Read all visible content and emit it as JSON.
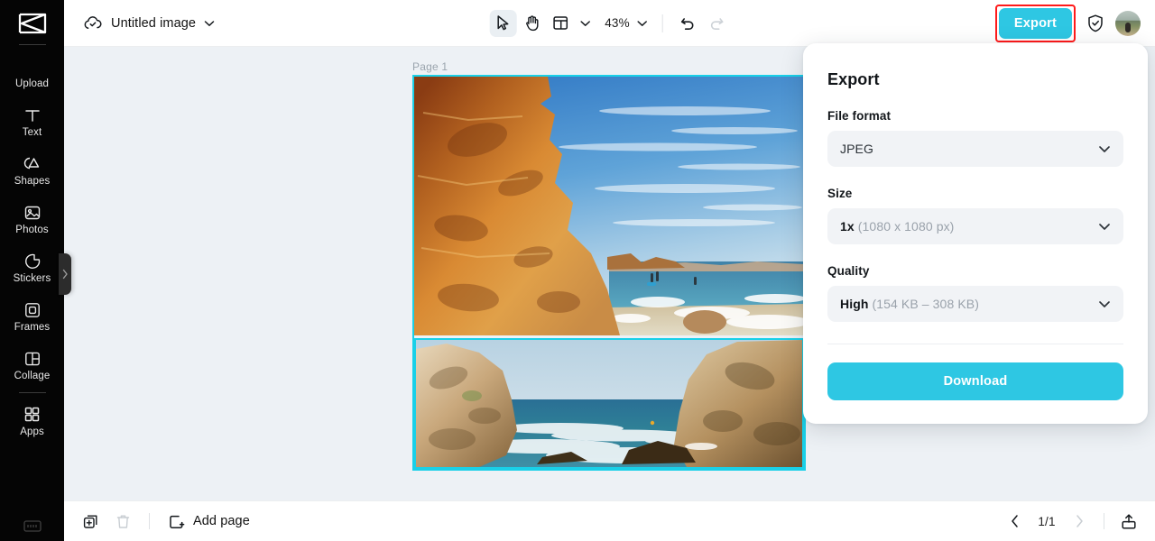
{
  "sidebar": {
    "logo_icon": "app-logo-icon",
    "items": [
      {
        "label": "Upload",
        "icon": "upload-icon"
      },
      {
        "label": "Text",
        "icon": "text-icon"
      },
      {
        "label": "Shapes",
        "icon": "shapes-icon"
      },
      {
        "label": "Photos",
        "icon": "photos-icon"
      },
      {
        "label": "Stickers",
        "icon": "stickers-icon"
      },
      {
        "label": "Frames",
        "icon": "frames-icon"
      },
      {
        "label": "Collage",
        "icon": "collage-icon"
      },
      {
        "label": "Apps",
        "icon": "apps-icon"
      }
    ],
    "bottom_icon": "keyboard-shortcuts-icon",
    "collapse_icon": "chevron-right-icon"
  },
  "topbar": {
    "cloud_icon": "cloud-saved-icon",
    "document_title": "Untitled image",
    "title_chevron_icon": "chevron-down-icon",
    "tools": [
      {
        "name": "select-tool",
        "icon": "cursor-arrow-icon",
        "active": true
      },
      {
        "name": "pan-tool",
        "icon": "hand-icon",
        "active": false
      },
      {
        "name": "resize-tool",
        "icon": "layout-resize-icon",
        "active": false
      }
    ],
    "resize_chevron_icon": "chevron-down-icon",
    "zoom_level": "43%",
    "zoom_chevron_icon": "chevron-down-icon",
    "undo_icon": "undo-icon",
    "redo_icon": "redo-icon",
    "export_label": "Export",
    "export_highlight_color": "#ff1a1a",
    "shield_icon": "shield-check-icon",
    "avatar_icon": "user-avatar"
  },
  "canvas": {
    "page_label": "Page 1",
    "selection_color": "#19d0e8",
    "photos": [
      {
        "name": "beach-cliff-photo",
        "alt": "Orange sandstone cliff beside a sunny beach and blue sea"
      },
      {
        "name": "rocky-shore-photo",
        "alt": "Rocky coastline with waves between two large boulders"
      }
    ]
  },
  "bottombar": {
    "duplicate_page_icon": "duplicate-page-icon",
    "delete_page_icon": "trash-icon",
    "add_page_icon": "add-page-icon",
    "add_page_label": "Add page",
    "prev_page_icon": "chevron-left-icon",
    "page_indicator": "1/1",
    "next_page_icon": "chevron-right-icon",
    "export_panel_icon": "export-tray-icon"
  },
  "export_panel": {
    "title": "Export",
    "file_format": {
      "label": "File format",
      "value": "JPEG",
      "chevron_icon": "chevron-down-icon"
    },
    "size": {
      "label": "Size",
      "value": "1x",
      "detail": "(1080 x 1080 px)",
      "chevron_icon": "chevron-down-icon"
    },
    "quality": {
      "label": "Quality",
      "value": "High",
      "detail": "(154 KB – 308 KB)",
      "chevron_icon": "chevron-down-icon"
    },
    "download_label": "Download",
    "accent_color": "#2ec7e3"
  }
}
